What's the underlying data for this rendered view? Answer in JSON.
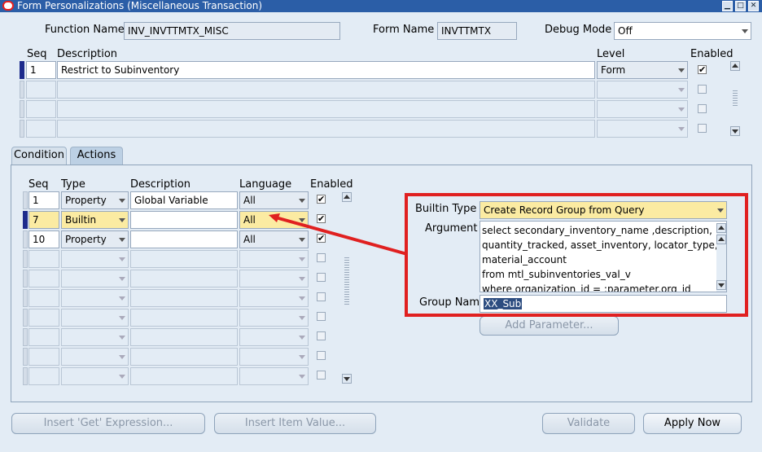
{
  "window": {
    "title": "Form Personalizations (Miscellaneous Transaction)"
  },
  "header": {
    "function_name_label": "Function Name",
    "function_name_value": "INV_INVTTMTX_MISC",
    "form_name_label": "Form Name",
    "form_name_value": "INVTTMTX",
    "debug_mode_label": "Debug Mode",
    "debug_mode_value": "Off"
  },
  "rules": {
    "col_seq": "Seq",
    "col_description": "Description",
    "col_level": "Level",
    "col_enabled": "Enabled",
    "rows": [
      {
        "seq": "1",
        "description": "Restrict to Subinventory",
        "level": "Form",
        "enabled": true
      }
    ]
  },
  "tabs": {
    "condition": "Condition",
    "actions": "Actions"
  },
  "actions": {
    "col_seq": "Seq",
    "col_type": "Type",
    "col_description": "Description",
    "col_language": "Language",
    "col_enabled": "Enabled",
    "rows": [
      {
        "seq": "1",
        "type": "Property",
        "description": "Global Variable",
        "language": "All",
        "enabled": true
      },
      {
        "seq": "7",
        "type": "Builtin",
        "description": "",
        "language": "All",
        "enabled": true
      },
      {
        "seq": "10",
        "type": "Property",
        "description": "",
        "language": "All",
        "enabled": true
      }
    ]
  },
  "builtin": {
    "type_label": "Builtin Type",
    "type_value": "Create Record Group from Query",
    "argument_label": "Argument",
    "argument_lines": [
      "select secondary_inventory_name ,description,",
      "quantity_tracked, asset_inventory, locator_type,",
      "material_account",
      " from mtl_subinventories_val_v",
      " where organization_id = :parameter.org_id"
    ],
    "group_name_label": "Group Name",
    "group_name_value": "XX_Sub",
    "add_parameter": "Add Parameter..."
  },
  "buttons": {
    "insert_get_expression": "Insert 'Get' Expression...",
    "insert_item_value": "Insert Item Value...",
    "validate": "Validate",
    "apply_now": "Apply Now"
  },
  "colors": {
    "title_bar": "#2b5ea7",
    "highlight_box": "#e02020",
    "required_field": "#fbeba2"
  }
}
